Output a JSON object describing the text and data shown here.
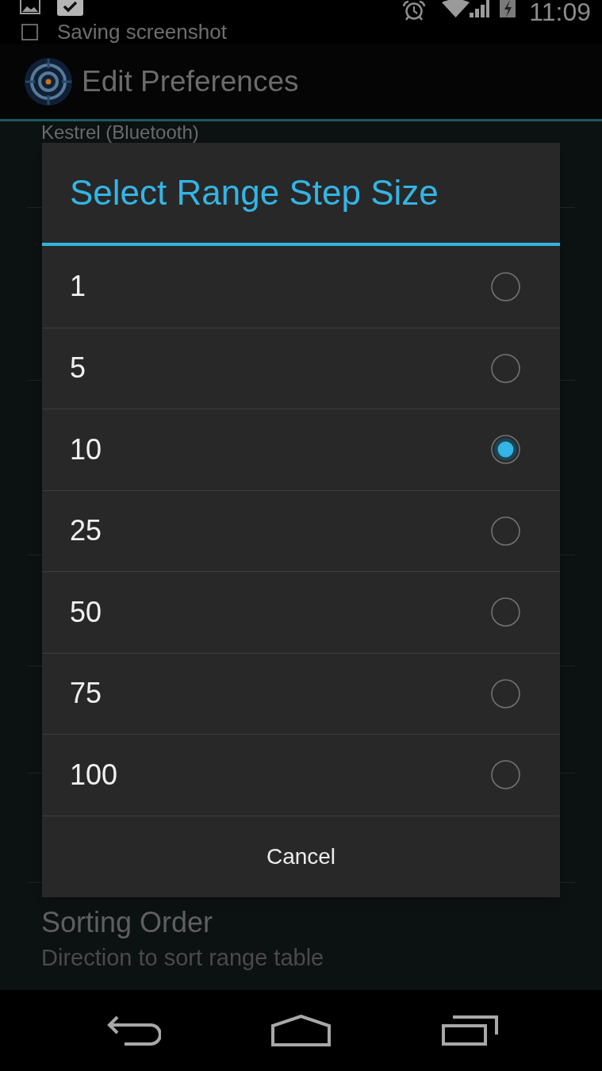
{
  "status_bar": {
    "time": "11:09",
    "ticker": "Saving screenshot"
  },
  "action_bar": {
    "title": "Edit Preferences"
  },
  "preference_behind_dialog": {
    "title": "Kestrel (Bluetooth)"
  },
  "preference_below_dialog": {
    "title": "Sorting Order",
    "summary": "Direction to sort range table"
  },
  "dialog": {
    "title": "Select Range Step Size",
    "options": [
      {
        "label": "1",
        "selected": false
      },
      {
        "label": "5",
        "selected": false
      },
      {
        "label": "10",
        "selected": true
      },
      {
        "label": "25",
        "selected": false
      },
      {
        "label": "50",
        "selected": false
      },
      {
        "label": "75",
        "selected": false
      },
      {
        "label": "100",
        "selected": false
      }
    ],
    "cancel_button": "Cancel"
  }
}
